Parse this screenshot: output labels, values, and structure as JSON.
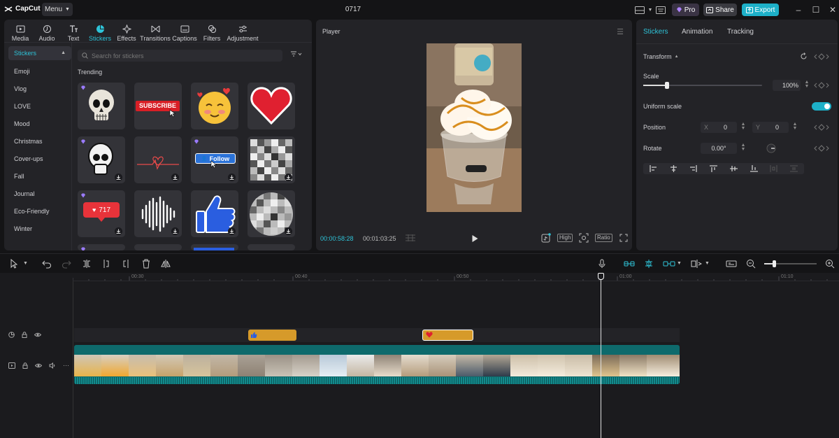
{
  "app": {
    "name": "CapCut",
    "menu_label": "Menu",
    "project_title": "0717",
    "pro_label": "Pro",
    "share_label": "Share",
    "export_label": "Export"
  },
  "media_tabs": [
    {
      "label": "Media",
      "icon": "media-icon"
    },
    {
      "label": "Audio",
      "icon": "audio-icon"
    },
    {
      "label": "Text",
      "icon": "text-icon"
    },
    {
      "label": "Stickers",
      "icon": "stickers-icon",
      "active": true
    },
    {
      "label": "Effects",
      "icon": "effects-icon"
    },
    {
      "label": "Transitions",
      "icon": "transitions-icon"
    },
    {
      "label": "Captions",
      "icon": "captions-icon"
    },
    {
      "label": "Filters",
      "icon": "filters-icon"
    },
    {
      "label": "Adjustment",
      "icon": "adjustment-icon"
    }
  ],
  "sticker_categories": [
    "Stickers",
    "Emoji",
    "Vlog",
    "LOVE",
    "Mood",
    "Christmas",
    "Cover-ups",
    "Fall",
    "Journal",
    "Eco-Friendly",
    "Winter"
  ],
  "search": {
    "placeholder": "Search for stickers"
  },
  "trending_label": "Trending",
  "sticker_grid": [
    {
      "name": "skull-sticker",
      "premium": true,
      "download": false
    },
    {
      "name": "subscribe-sticker",
      "text": "SUBSCRIBE",
      "premium": false,
      "download": false
    },
    {
      "name": "blushing-emoji-sticker",
      "premium": false,
      "download": false
    },
    {
      "name": "red-heart-sticker",
      "premium": false,
      "download": false
    },
    {
      "name": "skull-sketch-sticker",
      "premium": true,
      "download": true
    },
    {
      "name": "heartbeat-line-sticker",
      "premium": false,
      "download": true
    },
    {
      "name": "follow-button-sticker",
      "text": "Follow",
      "premium": true,
      "download": true
    },
    {
      "name": "mosaic-square-sticker",
      "premium": false,
      "download": true
    },
    {
      "name": "like-count-sticker",
      "text": "717",
      "premium": true,
      "download": true
    },
    {
      "name": "sound-wave-sticker",
      "premium": false,
      "download": true
    },
    {
      "name": "thumbs-up-sticker",
      "premium": false,
      "download": true
    },
    {
      "name": "mosaic-circle-sticker",
      "premium": false,
      "download": true
    }
  ],
  "player": {
    "title": "Player",
    "current_time": "00:00:58:28",
    "total_time": "00:01:03:25",
    "quality_label": "High",
    "ratio_label": "Ratio"
  },
  "inspector": {
    "tabs": [
      "Stickers",
      "Animation",
      "Tracking"
    ],
    "transform_label": "Transform",
    "scale_label": "Scale",
    "scale_value": "100%",
    "scale_fraction": 0.2,
    "uniform_scale_label": "Uniform scale",
    "uniform_scale_on": true,
    "position_label": "Position",
    "pos_x_label": "X",
    "pos_x": "0",
    "pos_y_label": "Y",
    "pos_y": "0",
    "rotate_label": "Rotate",
    "rotate_value": "0.00°"
  },
  "timeline": {
    "ruler_marks": [
      "00:30",
      "00:40",
      "00:50",
      "01:00",
      "01:10"
    ]
  },
  "colors": {
    "accent": "#2ec3d8",
    "export": "#1db0c8",
    "sticker_clip": "#d69a2a",
    "video_track": "#0e6a6c"
  }
}
